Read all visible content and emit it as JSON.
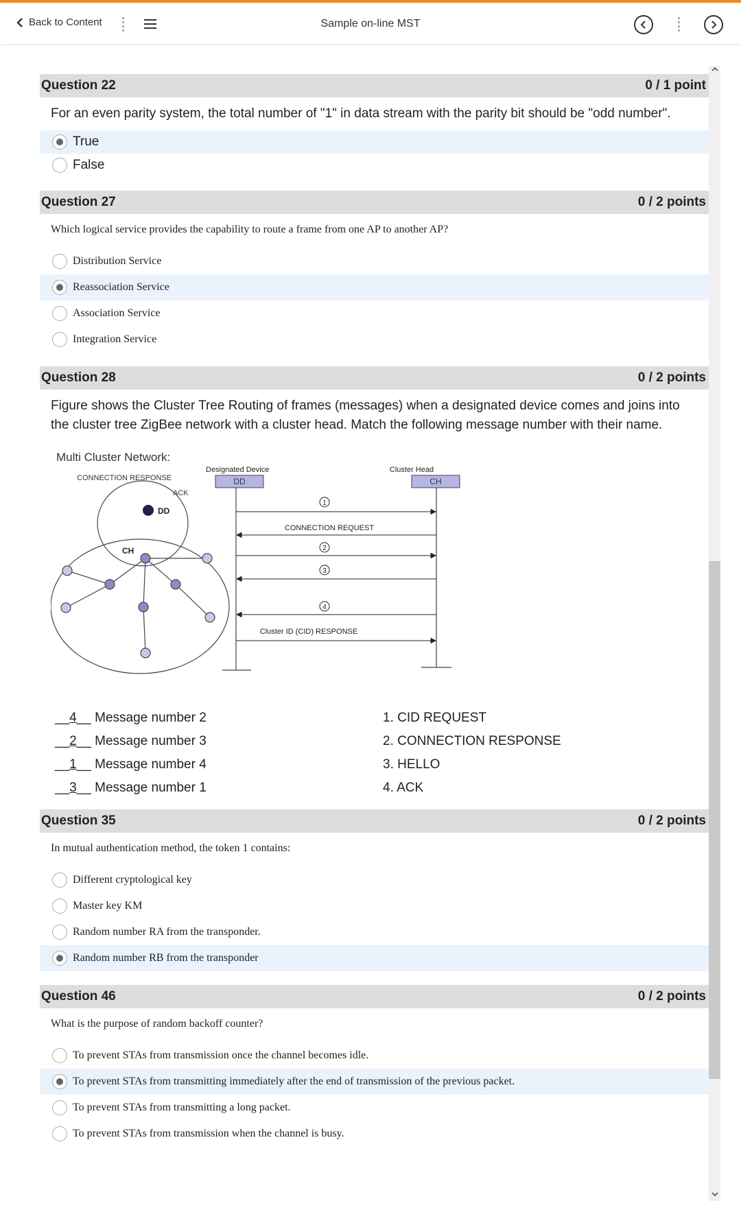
{
  "topbar": {
    "back_label": "Back to Content",
    "title": "Sample on-line MST"
  },
  "questions": {
    "q22": {
      "title": "Question 22",
      "points": "0 / 1 point",
      "text": "For an even parity system, the total number of \"1\" in data stream with the parity bit should be \"odd number\".",
      "options": [
        "True",
        "False"
      ],
      "selected_index": 0
    },
    "q27": {
      "title": "Question 27",
      "points": "0 / 2 points",
      "text": "Which logical service provides the capability to route a frame from one AP to another AP?",
      "options": [
        "Distribution Service",
        "Reassociation Service",
        "Association Service",
        "Integration Service"
      ],
      "selected_index": 1
    },
    "q28": {
      "title": "Question 28",
      "points": "0 / 2 points",
      "text": "Figure shows the Cluster Tree Routing of frames (messages) when a designated device comes and joins into the cluster tree ZigBee network with a cluster head. Match the following message number with their name.",
      "figure": {
        "title": "Multi Cluster Network:",
        "connection_response": "CONNECTION RESPONSE",
        "ack": "ACK",
        "dd_node": "DD",
        "ch_node": "CH",
        "designated_device": "Designated Device",
        "dd_box": "DD",
        "cluster_head": "Cluster Head",
        "ch_box": "CH",
        "connection_request": "CONNECTION REQUEST",
        "cid_response": "Cluster ID (CID) RESPONSE",
        "markers": [
          "1",
          "2",
          "3",
          "4"
        ]
      },
      "matches": [
        {
          "answer": "4",
          "label": "Message number 2"
        },
        {
          "answer": "2",
          "label": "Message number 3"
        },
        {
          "answer": "1",
          "label": "Message number 4"
        },
        {
          "answer": "3",
          "label": "Message number 1"
        }
      ],
      "choices": [
        {
          "num": "1.",
          "label": "CID REQUEST"
        },
        {
          "num": "2.",
          "label": "CONNECTION RESPONSE"
        },
        {
          "num": "3.",
          "label": "HELLO"
        },
        {
          "num": "4.",
          "label": "ACK"
        }
      ]
    },
    "q35": {
      "title": "Question 35",
      "points": "0 / 2 points",
      "text": "In mutual authentication method, the token 1 contains:",
      "options": [
        "Different cryptological key",
        "Master key KM",
        "Random number RA from the transponder.",
        "Random number RB from the transponder"
      ],
      "selected_index": 3
    },
    "q46": {
      "title": "Question 46",
      "points": "0 / 2 points",
      "text": "What is the purpose of random backoff counter?",
      "options": [
        "To prevent STAs from transmission once the channel becomes idle.",
        "To prevent STAs from transmitting immediately after the end of transmission of the previous packet.",
        "To prevent STAs from transmitting a long packet.",
        "To prevent STAs from transmission when the channel is busy."
      ],
      "selected_index": 1
    }
  }
}
